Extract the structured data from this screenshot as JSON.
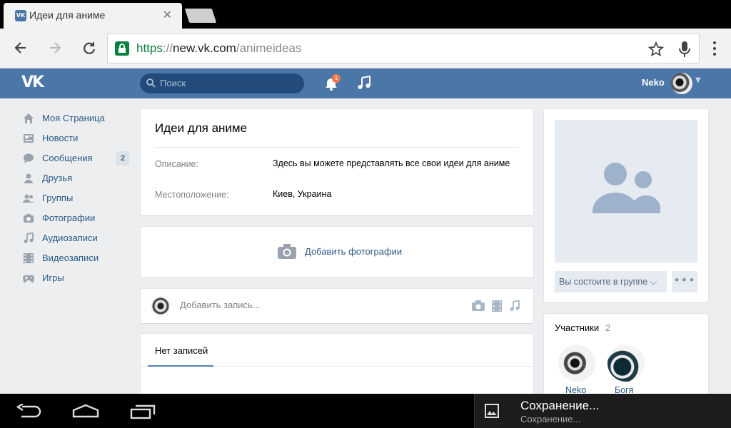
{
  "browser": {
    "tab_title": "Идеи для аниме",
    "tab_favicon": "VK",
    "url_scheme": "https",
    "url_sep": "://",
    "url_host": "new.vk.com",
    "url_path": "/animeideas"
  },
  "header": {
    "logo": "VK",
    "search_placeholder": "Поиск",
    "notifications_count": "1",
    "username": "Neko"
  },
  "sidebar": {
    "items": [
      {
        "label": "Моя Страница",
        "icon": "home-icon"
      },
      {
        "label": "Новости",
        "icon": "news-icon"
      },
      {
        "label": "Сообщения",
        "icon": "messages-icon",
        "count": "2"
      },
      {
        "label": "Друзья",
        "icon": "friends-icon"
      },
      {
        "label": "Группы",
        "icon": "groups-icon"
      },
      {
        "label": "Фотографии",
        "icon": "photos-icon"
      },
      {
        "label": "Аудиозаписи",
        "icon": "audio-icon"
      },
      {
        "label": "Видеозаписи",
        "icon": "video-icon"
      },
      {
        "label": "Игры",
        "icon": "games-icon"
      }
    ]
  },
  "group": {
    "title": "Идеи для аниме",
    "description_label": "Описание:",
    "description_value": "Здесь вы можете представлять все свои идеи для аниме",
    "location_label": "Местоположение:",
    "location_value": "Киев, Украина",
    "add_photos": "Добавить фотографии",
    "post_placeholder": "Добавить запись...",
    "wall_tab": "Нет записей",
    "member_button": "Вы состоите в группе",
    "more_button": "•••",
    "members_title": "Участники",
    "members_count": "2",
    "members": [
      {
        "name": "Neko"
      },
      {
        "name": "Богя"
      }
    ]
  },
  "notification": {
    "title": "Сохранение...",
    "subtitle": "Сохранение..."
  },
  "colors": {
    "vk_blue": "#4a76a8",
    "link": "#2a5885",
    "secure_green": "#0b8043"
  }
}
